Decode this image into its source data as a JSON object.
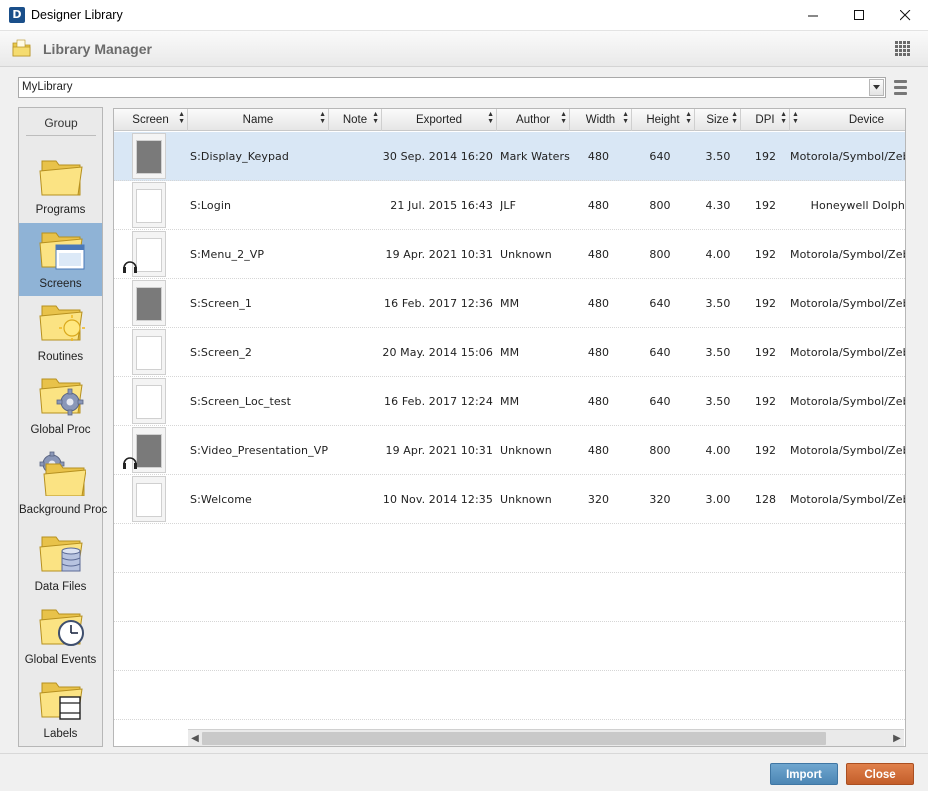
{
  "window": {
    "title": "Designer Library",
    "app_icon_letter": "D"
  },
  "header": {
    "title": "Library Manager"
  },
  "library_select": {
    "value": "MyLibrary"
  },
  "sidebar": {
    "heading": "Group",
    "items": [
      {
        "label": "Programs",
        "icon": "folder-icon",
        "active": false
      },
      {
        "label": "Screens",
        "icon": "folder-screens-icon",
        "active": true
      },
      {
        "label": "Routines",
        "icon": "folder-routines-icon",
        "active": false
      },
      {
        "label": "Global Proc",
        "icon": "folder-gear-icon",
        "active": false
      },
      {
        "label": "Background Proc",
        "icon": "gear-folder-icon",
        "active": false
      },
      {
        "label": "Data Files",
        "icon": "folder-database-icon",
        "active": false
      },
      {
        "label": "Global Events",
        "icon": "folder-clock-icon",
        "active": false
      },
      {
        "label": "Labels",
        "icon": "folder-label-icon",
        "active": false
      }
    ]
  },
  "table": {
    "columns": [
      "Screen",
      "Name",
      "Note",
      "Exported",
      "Author",
      "Width",
      "Height",
      "Size",
      "DPI",
      "Device"
    ],
    "rows": [
      {
        "name": "S:Display_Keypad",
        "note": "",
        "exported": "30 Sep. 2014 16:20",
        "author": "Mark Waters",
        "width": "480",
        "height": "640",
        "size": "3.50",
        "dpi": "192",
        "device": "Motorola/Symbol/Zeb",
        "headphones": false
      },
      {
        "name": "S:Login",
        "note": "",
        "exported": "21 Jul. 2015 16:43",
        "author": "JLF",
        "width": "480",
        "height": "800",
        "size": "4.30",
        "dpi": "192",
        "device": "Honeywell Dolph",
        "headphones": false
      },
      {
        "name": "S:Menu_2_VP",
        "note": "",
        "exported": "19 Apr. 2021 10:31",
        "author": "Unknown",
        "width": "480",
        "height": "800",
        "size": "4.00",
        "dpi": "192",
        "device": "Motorola/Symbol/Zeb",
        "headphones": true
      },
      {
        "name": "S:Screen_1",
        "note": "",
        "exported": "16 Feb. 2017 12:36",
        "author": "MM",
        "width": "480",
        "height": "640",
        "size": "3.50",
        "dpi": "192",
        "device": "Motorola/Symbol/Zeb",
        "headphones": false
      },
      {
        "name": "S:Screen_2",
        "note": "",
        "exported": "20 May. 2014 15:06",
        "author": "MM",
        "width": "480",
        "height": "640",
        "size": "3.50",
        "dpi": "192",
        "device": "Motorola/Symbol/Zeb",
        "headphones": false
      },
      {
        "name": "S:Screen_Loc_test",
        "note": "",
        "exported": "16 Feb. 2017 12:24",
        "author": "MM",
        "width": "480",
        "height": "640",
        "size": "3.50",
        "dpi": "192",
        "device": "Motorola/Symbol/Zeb",
        "headphones": false
      },
      {
        "name": "S:Video_Presentation_VP",
        "note": "",
        "exported": "19 Apr. 2021 10:31",
        "author": "Unknown",
        "width": "480",
        "height": "800",
        "size": "4.00",
        "dpi": "192",
        "device": "Motorola/Symbol/Zeb",
        "headphones": true
      },
      {
        "name": "S:Welcome",
        "note": "",
        "exported": "10 Nov. 2014 12:35",
        "author": "Unknown",
        "width": "320",
        "height": "320",
        "size": "3.00",
        "dpi": "128",
        "device": "Motorola/Symbol/Zebr",
        "headphones": false
      }
    ],
    "selected_row": 0
  },
  "footer": {
    "import_label": "Import",
    "close_label": "Close"
  },
  "colors": {
    "selection": "#d9e7f5",
    "active_group": "#8fb3d6",
    "import_button": "#5b93c0",
    "close_button": "#d06d39"
  }
}
